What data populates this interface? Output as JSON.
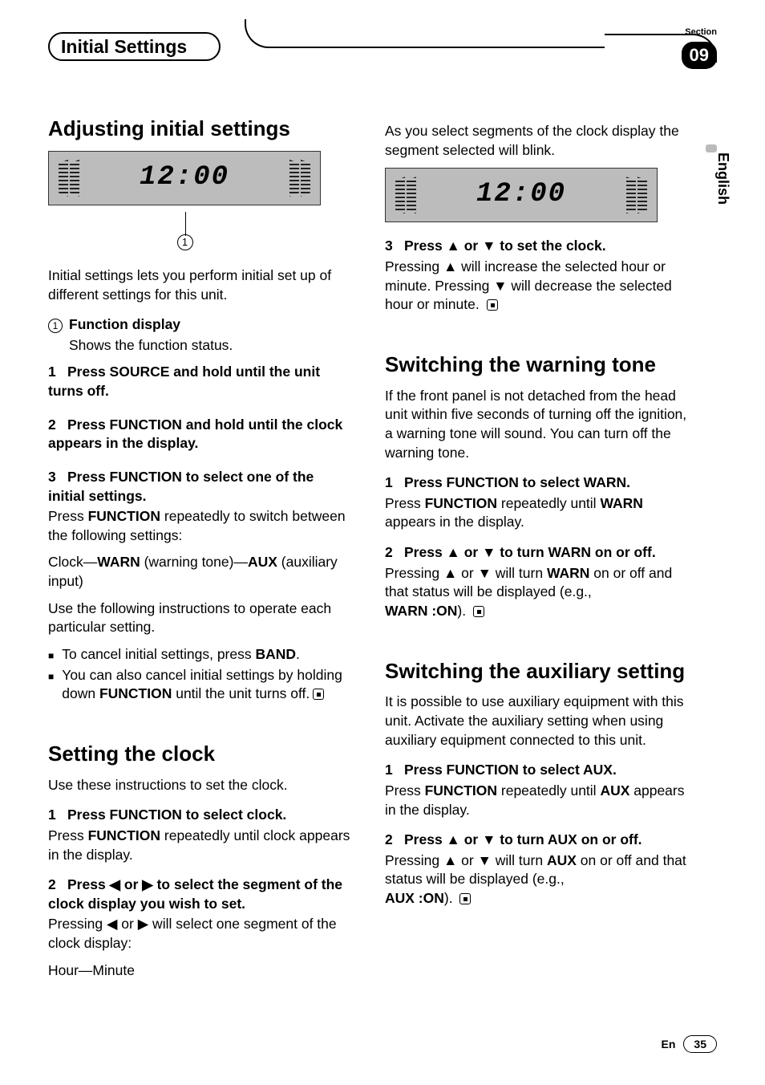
{
  "header": {
    "title": "Initial Settings",
    "section_label": "Section",
    "section_number": "09",
    "language": "English"
  },
  "footer": {
    "lang_code": "En",
    "page": "35"
  },
  "left": {
    "h_adjusting": "Adjusting initial settings",
    "lcd1": "12:00",
    "callout1": "1",
    "intro": "Initial settings lets you perform initial set up of different settings for this unit.",
    "fn_label_num": "1",
    "fn_label": "Function display",
    "fn_label_body": "Shows the function status.",
    "s1_num": "1",
    "s1_hd": "Press SOURCE and hold until the unit turns off.",
    "s2_num": "2",
    "s2_hd": "Press FUNCTION and hold until the clock appears in the display.",
    "s3_num": "3",
    "s3_hd": "Press FUNCTION to select one of the initial settings.",
    "s3_body1a": "Press ",
    "s3_body1b": "FUNCTION",
    "s3_body1c": " repeatedly to switch between the following settings:",
    "s3_body2a": "Clock—",
    "s3_body2b": "WARN",
    "s3_body2c": " (warning tone)—",
    "s3_body2d": "AUX",
    "s3_body2e": " (auxiliary input)",
    "s3_body3": "Use the following instructions to operate each particular setting.",
    "bullet1a": "To cancel initial settings, press ",
    "bullet1b": "BAND",
    "bullet1c": ".",
    "bullet2a": "You can also cancel initial settings by holding down ",
    "bullet2b": "FUNCTION",
    "bullet2c": " until the unit turns off.",
    "h_clock": "Setting the clock",
    "clock_intro": "Use these instructions to set the clock.",
    "c1_num": "1",
    "c1_hd": "Press FUNCTION to select clock.",
    "c1_body_a": "Press ",
    "c1_body_b": "FUNCTION",
    "c1_body_c": " repeatedly until clock appears in the display.",
    "c2_num": "2",
    "c2_hd_a": "Press ",
    "c2_hd_b": " or ",
    "c2_hd_c": " to select the segment of the clock display you wish to set.",
    "c2_body_a": "Pressing ",
    "c2_body_b": " or ",
    "c2_body_c": " will select one segment of the clock display:",
    "c2_body2": "Hour—Minute"
  },
  "right": {
    "top": "As you select segments of the clock display the segment selected will blink.",
    "lcd2": "12:00",
    "r3_num": "3",
    "r3_hd_a": "Press ",
    "r3_hd_b": " or ",
    "r3_hd_c": " to set the clock.",
    "r3_body_a": "Pressing ",
    "r3_body_b": " will increase the selected hour or minute. Pressing ",
    "r3_body_c": " will decrease the selected hour or minute.",
    "h_warn": "Switching the warning tone",
    "warn_intro": "If the front panel is not detached from the head unit within five seconds of turning off the ignition, a warning tone will sound. You can turn off the warning tone.",
    "w1_num": "1",
    "w1_hd": "Press FUNCTION to select WARN.",
    "w1_body_a": "Press ",
    "w1_body_b": "FUNCTION",
    "w1_body_c": " repeatedly until ",
    "w1_body_d": "WARN",
    "w1_body_e": " appears in the display.",
    "w2_num": "2",
    "w2_hd_a": "Press ",
    "w2_hd_b": " or ",
    "w2_hd_c": " to turn WARN on or off.",
    "w2_body_a": "Pressing ",
    "w2_body_b": " or ",
    "w2_body_c": " will turn ",
    "w2_body_d": "WARN",
    "w2_body_e": " on or off and that status will be displayed (e.g., ",
    "w2_body_f": "WARN :ON",
    "w2_body_g": ").",
    "h_aux": "Switching the auxiliary setting",
    "aux_intro": "It is possible to use auxiliary equipment with this unit. Activate the auxiliary setting when using auxiliary equipment connected to this unit.",
    "a1_num": "1",
    "a1_hd": "Press FUNCTION to select AUX.",
    "a1_body_a": "Press ",
    "a1_body_b": "FUNCTION",
    "a1_body_c": " repeatedly until ",
    "a1_body_d": "AUX",
    "a1_body_e": " appears in the display.",
    "a2_num": "2",
    "a2_hd_a": "Press ",
    "a2_hd_b": " or ",
    "a2_hd_c": " to turn AUX on or off.",
    "a2_body_a": "Pressing ",
    "a2_body_b": " or ",
    "a2_body_c": " will turn ",
    "a2_body_d": "AUX",
    "a2_body_e": " on or off and that status will be displayed (e.g., ",
    "a2_body_f": "AUX :ON",
    "a2_body_g": ")."
  },
  "glyphs": {
    "up": "▲",
    "down": "▼",
    "left": "◀",
    "right": "▶",
    "bullet": "■"
  }
}
